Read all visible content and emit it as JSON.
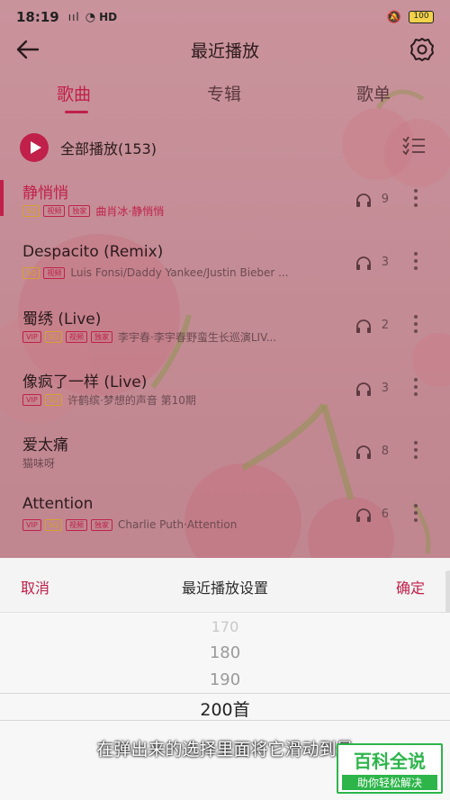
{
  "status_bar": {
    "time": "18:19",
    "signal": "ııl",
    "network": "HD",
    "battery": "100"
  },
  "header": {
    "title": "最近播放",
    "back_icon": "arrow-left-icon",
    "settings_icon": "gear-icon"
  },
  "tabs": [
    {
      "label": "歌曲",
      "active": true
    },
    {
      "label": "专辑",
      "active": false
    },
    {
      "label": "歌单",
      "active": false
    }
  ],
  "play_all": {
    "label": "全部播放(153)",
    "icon": "play-circle-icon",
    "sort_icon": "sort-list-icon"
  },
  "songs": [
    {
      "title": "静悄悄",
      "tags": [
        "SQ",
        "视频",
        "独家"
      ],
      "artist": "曲肖冰·静悄悄",
      "plays": "9",
      "playing": true
    },
    {
      "title": "Despacito (Remix)",
      "tags": [
        "SQ",
        "视频"
      ],
      "artist": "Luis Fonsi/Daddy Yankee/Justin Bieber ...",
      "plays": "3",
      "playing": false
    },
    {
      "title": "蜀绣 (Live)",
      "tags": [
        "VIP",
        "SQ",
        "视频",
        "独家"
      ],
      "artist": "李宇春·李宇春野蛮生长巡演LIV...",
      "plays": "2",
      "playing": false
    },
    {
      "title": "像疯了一样 (Live)",
      "tags": [
        "VIP",
        "SQ"
      ],
      "artist": "许鹤缤·梦想的声音 第10期",
      "plays": "3",
      "playing": false
    },
    {
      "title": "爱太痛",
      "tags": [],
      "artist": "猫味呀",
      "plays": "8",
      "playing": false
    },
    {
      "title": "Attention",
      "tags": [
        "VIP",
        "SQ",
        "视频",
        "独家"
      ],
      "artist": "Charlie Puth·Attention",
      "plays": "6",
      "playing": false
    }
  ],
  "sheet": {
    "cancel": "取消",
    "title": "最近播放设置",
    "confirm": "确定",
    "options": [
      "170",
      "180",
      "190",
      "200首"
    ],
    "selected": "200首"
  },
  "subtitle": "在弹出来的选择里面将它滑动到最",
  "watermark": {
    "main": "百科全说",
    "sub": "助你轻松解决"
  },
  "colors": {
    "accent": "#c0204a",
    "sq": "#d7a030",
    "watermark": "#2db54a"
  }
}
